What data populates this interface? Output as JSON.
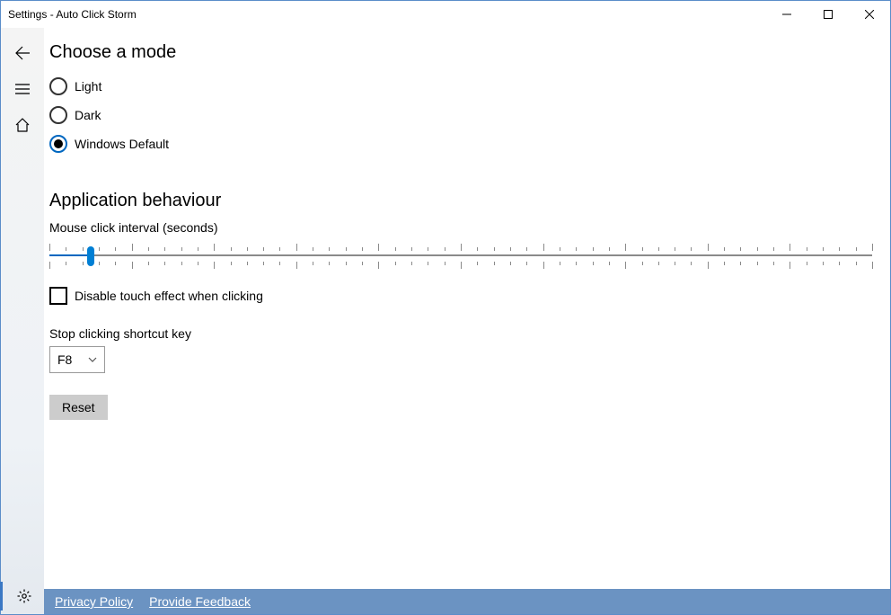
{
  "window": {
    "title": "Settings - Auto Click Storm"
  },
  "sections": {
    "mode_title": "Choose a mode",
    "behaviour_title": "Application behaviour"
  },
  "mode": {
    "options": [
      {
        "label": "Light",
        "selected": false
      },
      {
        "label": "Dark",
        "selected": false
      },
      {
        "label": "Windows Default",
        "selected": true
      }
    ]
  },
  "behaviour": {
    "interval_label": "Mouse click interval (seconds)",
    "interval_value_percent": 5,
    "touch_checkbox_label": "Disable touch effect when clicking",
    "touch_checkbox_checked": false,
    "shortcut_label": "Stop clicking shortcut key",
    "shortcut_value": "F8",
    "reset_label": "Reset"
  },
  "footer": {
    "privacy": "Privacy Policy",
    "feedback": "Provide Feedback"
  }
}
